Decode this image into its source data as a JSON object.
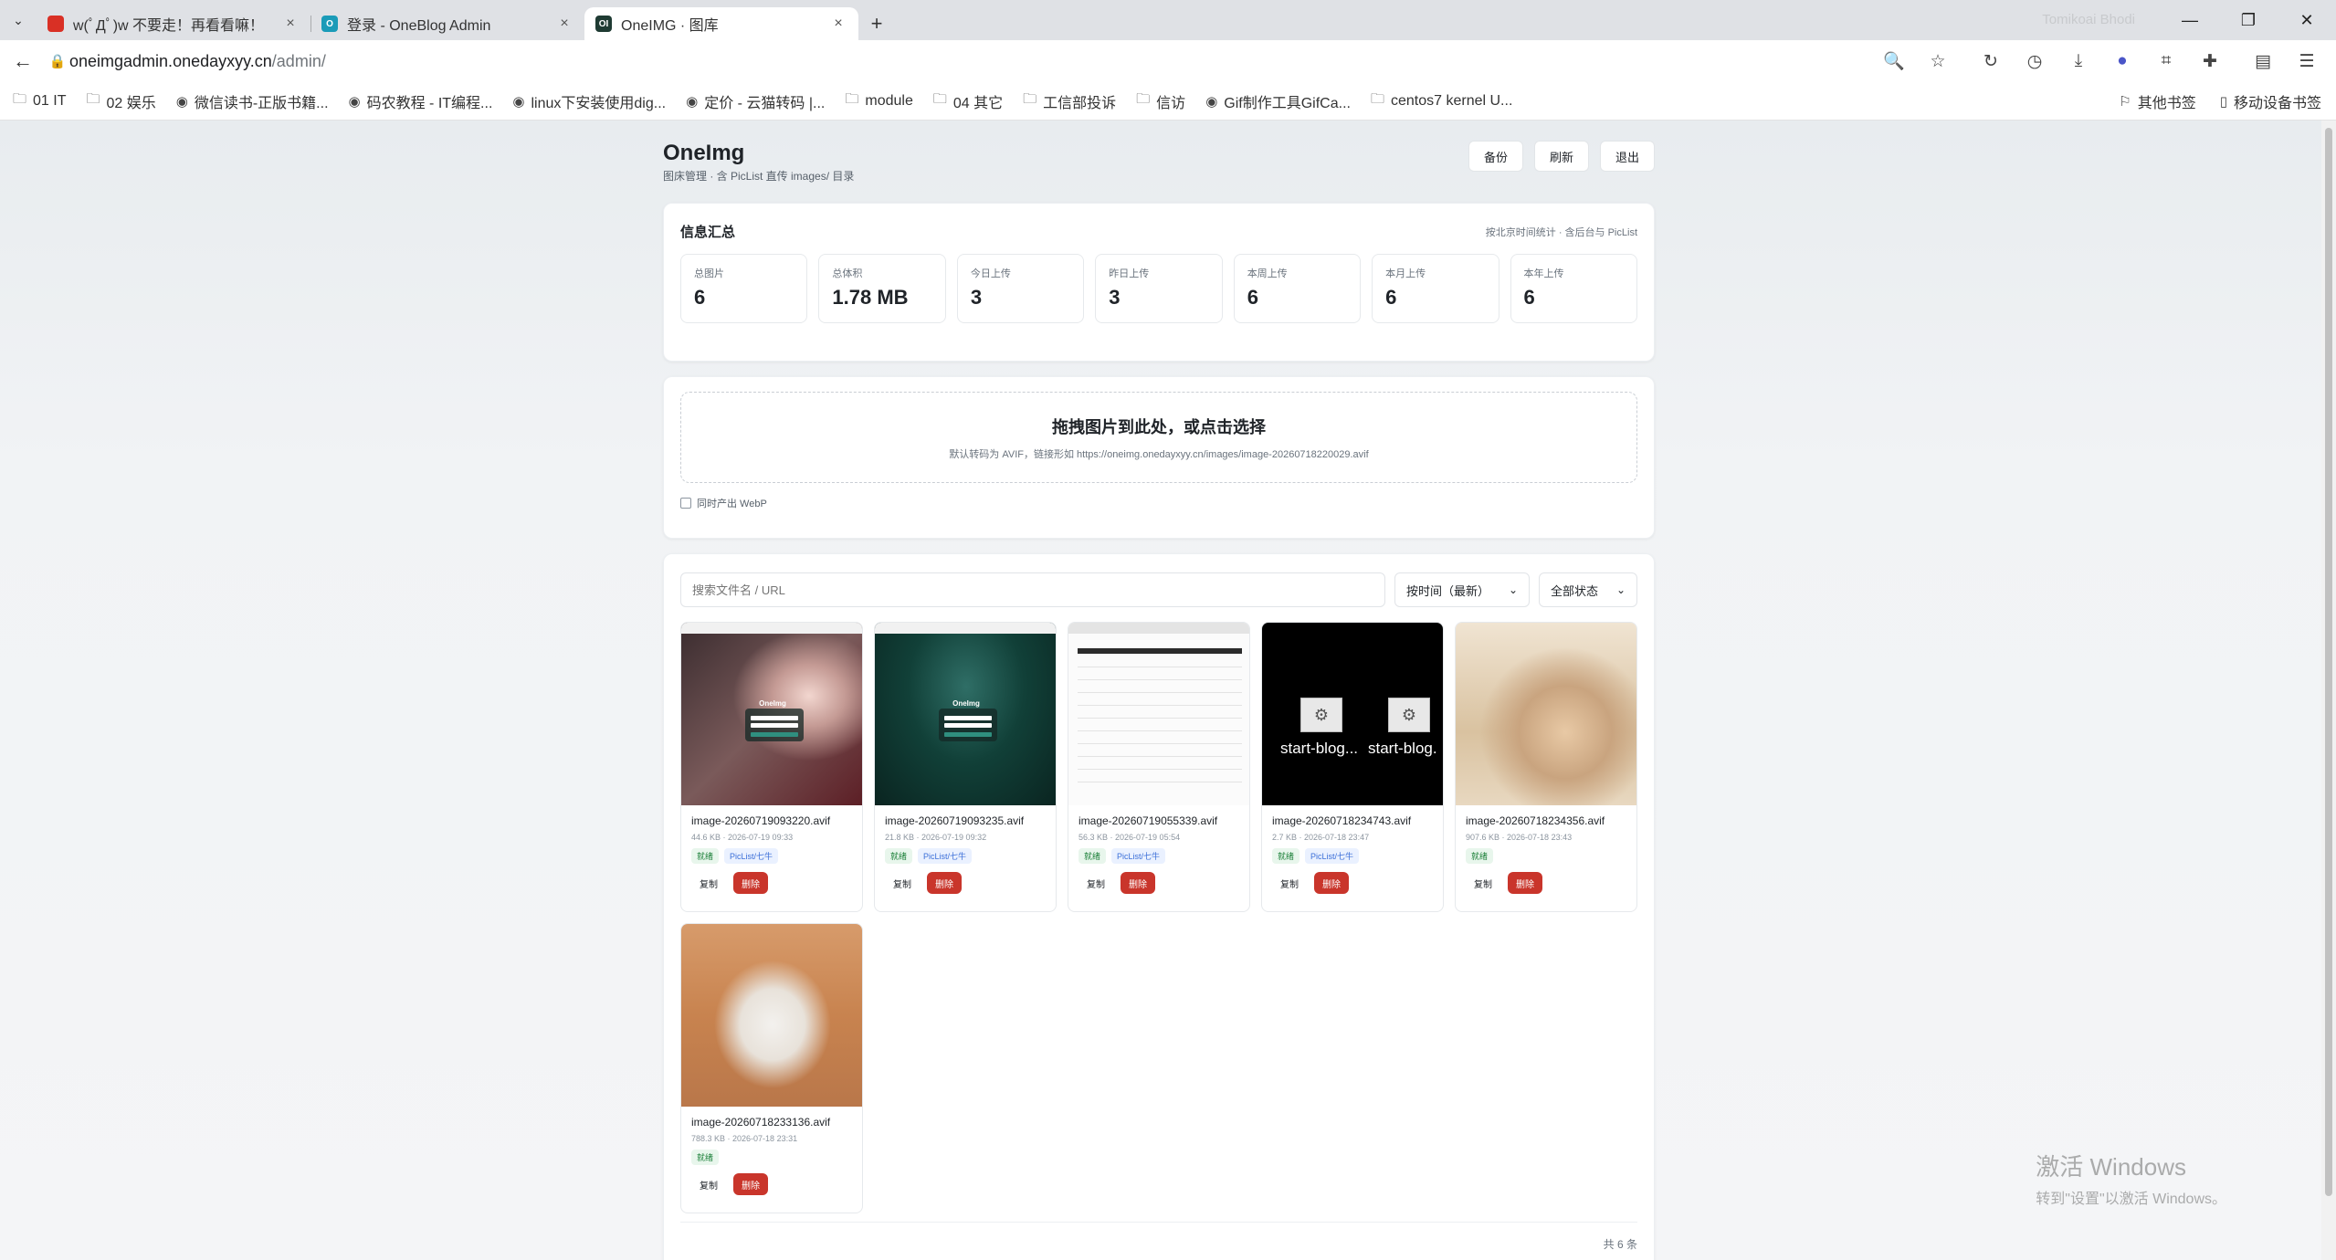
{
  "browser": {
    "tabs": [
      {
        "title": "w(ﾟДﾟ)w 不要走！再看看嘛！",
        "close": "×",
        "color": "#d93025"
      },
      {
        "title": "登录 - OneBlog Admin",
        "close": "×",
        "color": "#1a9bb8"
      },
      {
        "title": "OneIMG · 图库",
        "close": "×",
        "color": "#1f3b33",
        "favicon_text": "OI"
      }
    ],
    "new_tab": "+",
    "ghost_user": "Tomikoai Bhodi",
    "window_controls": {
      "minimize": "—",
      "restore": "❐",
      "close": "✕"
    },
    "url_host": "oneimgadmin.onedayxyy.cn",
    "url_path": "/admin/",
    "bookmarks": [
      {
        "label": "01 IT",
        "icon": "folder-icon"
      },
      {
        "label": "02 娱乐",
        "icon": "folder-icon"
      },
      {
        "label": "微信读书-正版书籍...",
        "icon": "globe-icon"
      },
      {
        "label": "码农教程 - IT编程...",
        "icon": "globe-icon"
      },
      {
        "label": "linux下安装使用dig...",
        "icon": "globe-icon"
      },
      {
        "label": "定价 - 云猫转码 |...",
        "icon": "globe-icon"
      },
      {
        "label": "module",
        "icon": "folder-icon"
      },
      {
        "label": "04 其它",
        "icon": "folder-icon"
      },
      {
        "label": "工信部投诉",
        "icon": "folder-icon"
      },
      {
        "label": "信访",
        "icon": "folder-icon"
      },
      {
        "label": "Gif制作工具GifCa...",
        "icon": "globe-icon"
      },
      {
        "label": "centos7 kernel U...",
        "icon": "folder-icon"
      }
    ],
    "bookmarks_right": [
      {
        "label": "其他书签",
        "icon": "bookmark-icon"
      },
      {
        "label": "移动设备书签",
        "icon": "mobile-icon"
      }
    ]
  },
  "app": {
    "brand": "OneImg",
    "subtitle": "图床管理 · 含 PicList 直传 images/ 目录",
    "buttons": {
      "backup": "备份",
      "refresh": "刷新",
      "logout": "退出"
    }
  },
  "stats": {
    "title": "信息汇总",
    "note": "按北京时间统计 · 含后台与 PicList",
    "items": [
      {
        "label": "总图片",
        "value": "6"
      },
      {
        "label": "总体积",
        "value": "1.78 MB"
      },
      {
        "label": "今日上传",
        "value": "3"
      },
      {
        "label": "昨日上传",
        "value": "3"
      },
      {
        "label": "本周上传",
        "value": "6"
      },
      {
        "label": "本月上传",
        "value": "6"
      },
      {
        "label": "本年上传",
        "value": "6"
      }
    ]
  },
  "upload": {
    "title": "拖拽图片到此处，或点击选择",
    "hint": "默认转码为 AVIF，链接形如 https://oneimg.onedayxyy.cn/images/image-20260718220029.avif",
    "webp_label": "同时产出 WebP"
  },
  "filters": {
    "search_placeholder": "搜索文件名 / URL",
    "sort_value": "按时间（最新）",
    "status_value": "全部状态"
  },
  "images": [
    {
      "name": "image-20260719093220.avif",
      "info": "44.6 KB · 2026-07-19 09:33",
      "tags": [
        "就绪",
        "PicList/七牛"
      ],
      "copy": "复制",
      "delete": "删除"
    },
    {
      "name": "image-20260719093235.avif",
      "info": "21.8 KB · 2026-07-19 09:32",
      "tags": [
        "就绪",
        "PicList/七牛"
      ],
      "copy": "复制",
      "delete": "删除"
    },
    {
      "name": "image-20260719055339.avif",
      "info": "56.3 KB · 2026-07-19 05:54",
      "tags": [
        "就绪",
        "PicList/七牛"
      ],
      "copy": "复制",
      "delete": "删除"
    },
    {
      "name": "image-20260718234743.avif",
      "info": "2.7 KB · 2026-07-18 23:47",
      "tags": [
        "就绪",
        "PicList/七牛"
      ],
      "copy": "复制",
      "delete": "删除"
    },
    {
      "name": "image-20260718234356.avif",
      "info": "907.6 KB · 2026-07-18 23:43",
      "tags": [
        "就绪"
      ],
      "copy": "复制",
      "delete": "删除"
    },
    {
      "name": "image-20260718233136.avif",
      "info": "788.3 KB · 2026-07-18 23:31",
      "tags": [
        "就绪"
      ],
      "copy": "复制",
      "delete": "删除"
    }
  ],
  "thumb_text": {
    "logo": "OneImg",
    "win_label": "start-blog...",
    "win_label2": "start-blog."
  },
  "total": "共 6 条",
  "watermark": {
    "line1": "激活 Windows",
    "line2": "转到\"设置\"以激活 Windows。"
  },
  "colors": {
    "danger": "#c9352b",
    "ok_tag": "#1a7f37",
    "src_tag": "#3b6fd8"
  }
}
